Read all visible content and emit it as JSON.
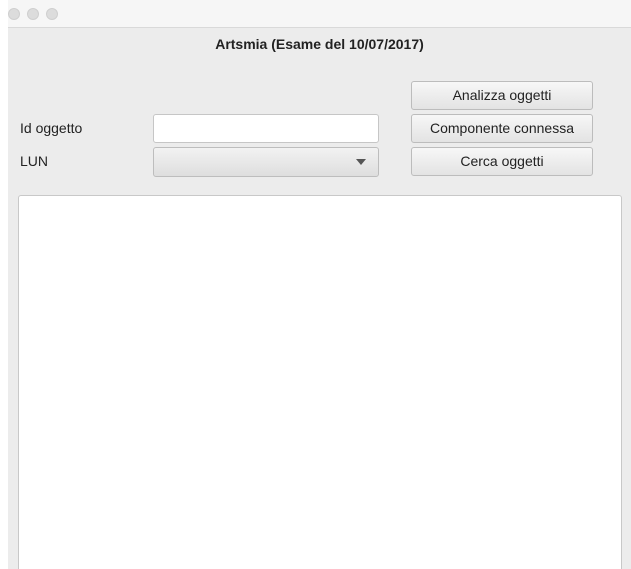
{
  "window": {
    "title": "Artsmia (Esame del 10/07/2017)"
  },
  "form": {
    "id_label": "Id oggetto",
    "id_value": "",
    "lun_label": "LUN",
    "lun_selected": ""
  },
  "buttons": {
    "analizza": "Analizza oggetti",
    "componente": "Componente connessa",
    "cerca": "Cerca oggetti"
  },
  "output": {
    "text": ""
  }
}
